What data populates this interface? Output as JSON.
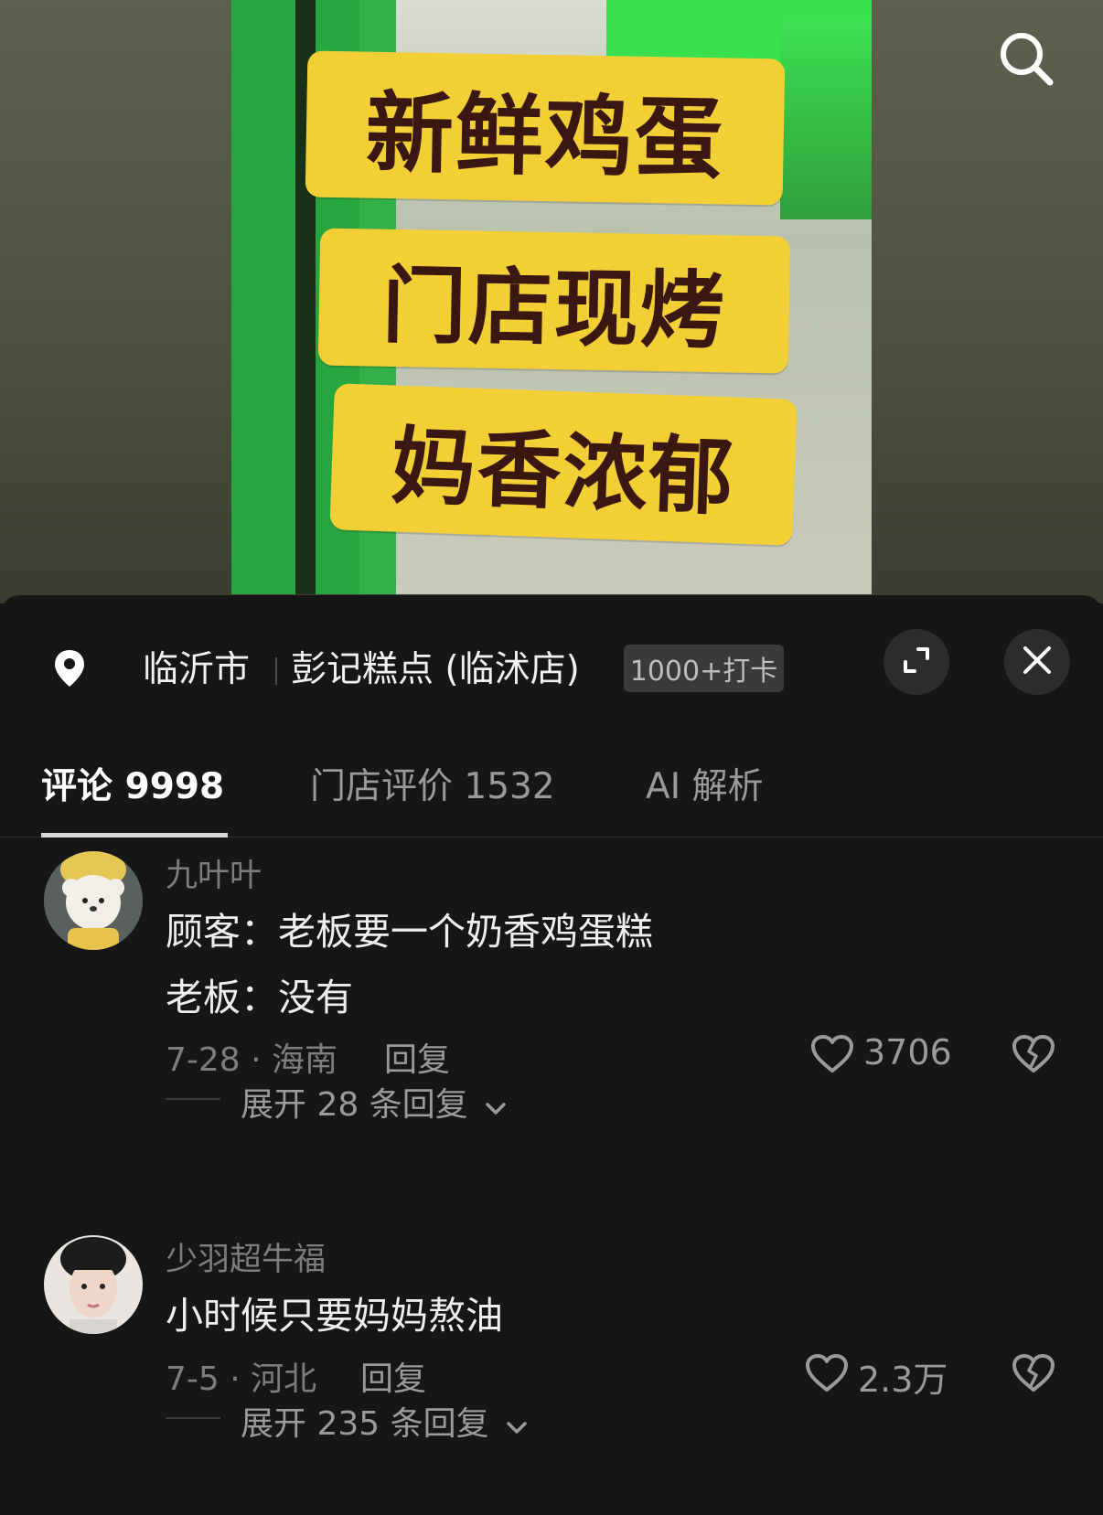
{
  "video": {
    "sign_lines": [
      "新鲜鸡蛋",
      "门店现烤",
      "妈香浓郁"
    ]
  },
  "location": {
    "city": "临沂市",
    "shop": "彭记糕点 (临沭店)",
    "badge": "1000+打卡"
  },
  "tabs": [
    {
      "label": "评论 9998",
      "active": true
    },
    {
      "label": "门店评价 1532",
      "active": false
    },
    {
      "label": "AI 解析",
      "active": false
    }
  ],
  "comments": [
    {
      "user": "九叶叶",
      "lines": [
        "顾客：老板要一个奶香鸡蛋糕",
        "老板：没有"
      ],
      "meta": "7-28 · 海南",
      "reply": "回复",
      "likes": "3706",
      "expand": "展开 28 条回复"
    },
    {
      "user": "少羽超牛福",
      "lines": [
        "小时候只要妈妈熬油"
      ],
      "meta": "7-5 · 河北",
      "reply": "回复",
      "likes": "2.3万",
      "expand": "展开 235 条回复"
    }
  ],
  "icons": {
    "search": "search-icon",
    "pin": "location-pin-icon",
    "expand": "expand-icon",
    "close": "close-icon",
    "heart": "heart-icon",
    "dislike": "broken-heart-icon",
    "chevron": "chevron-down-icon"
  },
  "colors": {
    "sheet_bg": "#161616",
    "sign_bg": "#f3cf36",
    "sign_text": "#3b1712",
    "frame_green": "#27a640"
  }
}
